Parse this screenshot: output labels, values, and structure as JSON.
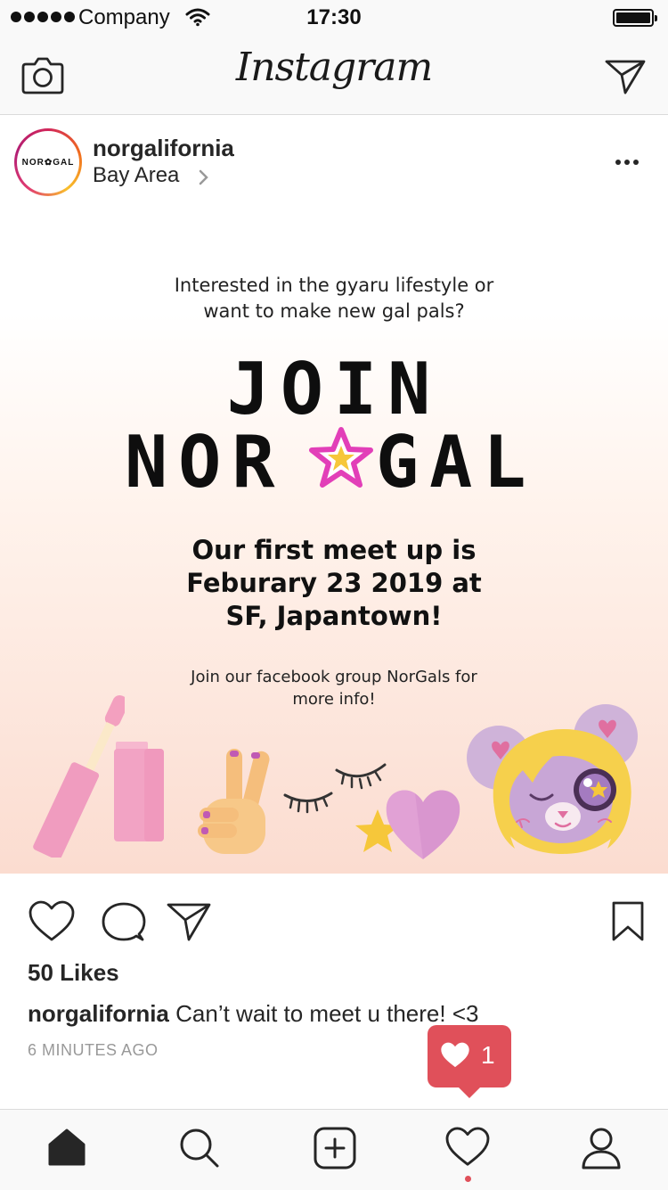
{
  "status_bar": {
    "carrier": "Company",
    "time": "17:30"
  },
  "header": {
    "logo": "Instagram"
  },
  "post": {
    "username": "norgalifornia",
    "location": "Bay Area",
    "avatar_text": "NOR✿GAL",
    "image": {
      "intro_line1": "Interested in the gyaru lifestyle or",
      "intro_line2": "want to make new gal pals?",
      "headline1": "JOIN",
      "headline2_left": "NOR",
      "headline2_right": "GAL",
      "meet_line1": "Our first meet up is",
      "meet_line2": "Feburary 23 2019 at",
      "meet_line3": "SF, Japantown!",
      "fb_line1": "Join our facebook group NorGals for",
      "fb_line2": "more info!"
    },
    "likes": "50 Likes",
    "caption_user": "norgalifornia",
    "caption_text": " Can’t wait to meet u there! <3",
    "time_ago": "6 MINUTES AGO"
  },
  "notification": {
    "count": "1"
  },
  "colors": {
    "accent": "#e0505a",
    "star": "#e23fb8",
    "pink": "#f2a7c4"
  },
  "icons": [
    "camera-icon",
    "send-icon",
    "more-icon",
    "heart-icon",
    "comment-icon",
    "bookmark-icon",
    "home-icon",
    "search-icon",
    "add-icon",
    "activity-icon",
    "profile-icon"
  ]
}
